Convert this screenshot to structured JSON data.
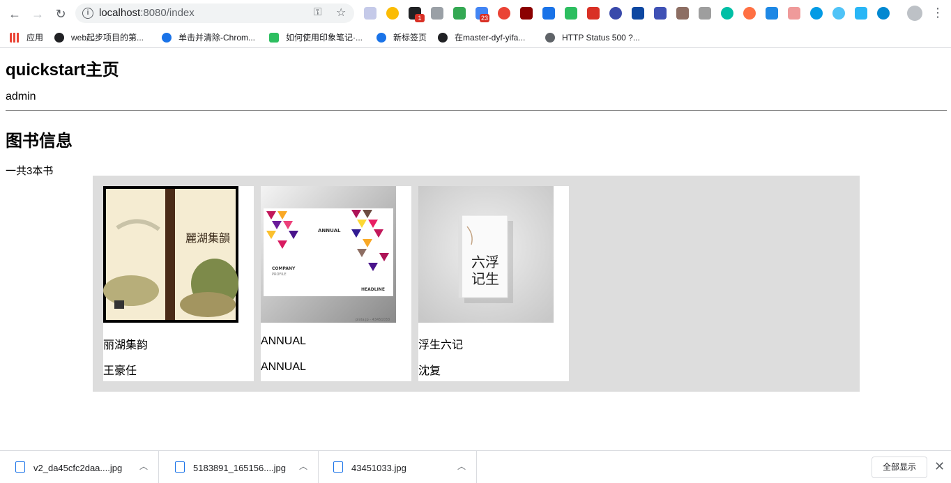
{
  "browser": {
    "url_host": "localhost",
    "url_path": ":8080/index",
    "notification_badges": [
      "1",
      "23"
    ]
  },
  "bookmarks": [
    {
      "label": "应用",
      "icon": "apps-grid-icon"
    },
    {
      "label": "web起步项目的第...",
      "icon": "github-icon"
    },
    {
      "label": "单击并清除-Chrom...",
      "icon": "puzzle-icon"
    },
    {
      "label": "如何使用印象笔记·...",
      "icon": "evernote-icon"
    },
    {
      "label": "新标签页",
      "icon": "bank-icon"
    },
    {
      "label": "在master-dyf-yifa...",
      "icon": "github-icon"
    },
    {
      "label": "HTTP Status 500 ?...",
      "icon": "globe-icon"
    }
  ],
  "page": {
    "title": "quickstart主页",
    "user": "admin",
    "section_title": "图书信息",
    "book_count": "一共3本书"
  },
  "books": [
    {
      "title": "丽湖集韵",
      "author": "王豪任",
      "cover": "landscape-painting-cover"
    },
    {
      "title": "ANNUAL",
      "author": "ANNUAL",
      "cover": "triangle-brochure-cover"
    },
    {
      "title": "浮生六记",
      "author": "沈复",
      "cover": "minimal-book-cover"
    }
  ],
  "cover_text": {
    "book1_title": "麗湖集韻",
    "book2_heading": "ANNUAL",
    "book2_company": "COMPANY",
    "book2_profile": "PROFILE",
    "book2_headline": "HEADLINE",
    "book2_watermark": "pixta.jp - 43451033",
    "book3_title_a": "六浮",
    "book3_title_b": "记生"
  },
  "downloads": {
    "items": [
      {
        "name": "v2_da45cfc2daa....jpg"
      },
      {
        "name": "5183891_165156....jpg"
      },
      {
        "name": "43451033.jpg"
      }
    ],
    "show_all": "全部显示"
  },
  "colors": {
    "shelf_bg": "#dddddd",
    "accent": "#1a73e8"
  }
}
